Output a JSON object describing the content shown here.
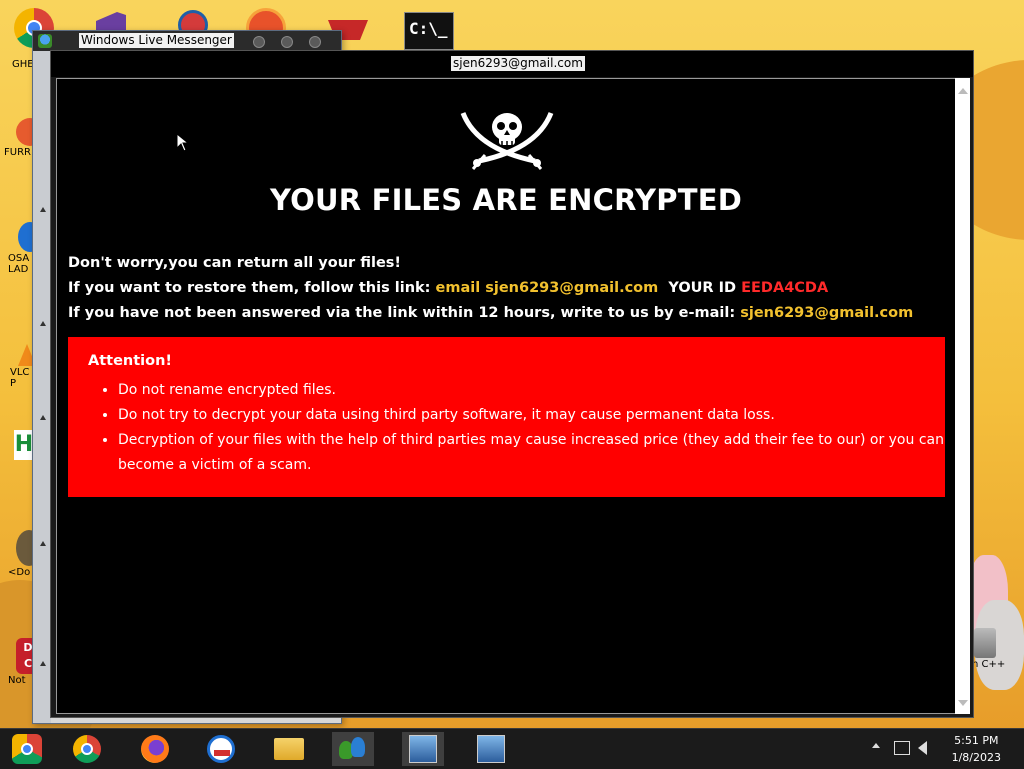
{
  "desktop": {
    "icons_left": [
      {
        "label": "GHE D",
        "icon": "chrome-icon"
      },
      {
        "label": "FURR",
        "icon": "furr-icon"
      },
      {
        "label": "OSA LAD",
        "icon": "osa-icon"
      },
      {
        "label": "VLC P",
        "icon": "vlc-icon"
      },
      {
        "label": "",
        "icon": "h-icon"
      },
      {
        "label": "<Do",
        "icon": "do-icon"
      },
      {
        "label": "Not",
        "icon": "not-icon"
      }
    ],
    "icons_right": [
      {
        "label": "n C++",
        "icon": "recycle-bin-icon"
      }
    ]
  },
  "messenger_window": {
    "title": "Windows Live Messenger"
  },
  "ransom_window": {
    "title": "sjen6293@gmail.com",
    "headline": "YOUR FILES ARE ENCRYPTED",
    "line1": "Don't worry,you can return all your files!",
    "line2_prefix": "If you want to restore them, follow this link: ",
    "line2_link": "email sjen6293@gmail.com",
    "line2_id_label": "  YOUR ID ",
    "line2_id_value": "EEDA4CDA",
    "line3_prefix": "If you have not been answered via the link within 12 hours, write to us by e-mail: ",
    "line3_email": "sjen6293@gmail.com",
    "attention_title": "Attention!",
    "attention_items": [
      "Do not rename encrypted files.",
      "Do not try to decrypt your data using third party software, it may cause permanent data loss.",
      "Decryption of your files with the help of third parties may cause increased price (they add their fee to our) or you can become a victim of a scam."
    ]
  },
  "taskbar": {
    "time": "5:51 PM",
    "date": "1/8/2023"
  },
  "colors": {
    "headline": "#ffffff",
    "link_yellow": "#f2c12e",
    "id_red": "#ff2a2a",
    "attention_bg": "#ff0000",
    "window_bg": "#000000"
  }
}
